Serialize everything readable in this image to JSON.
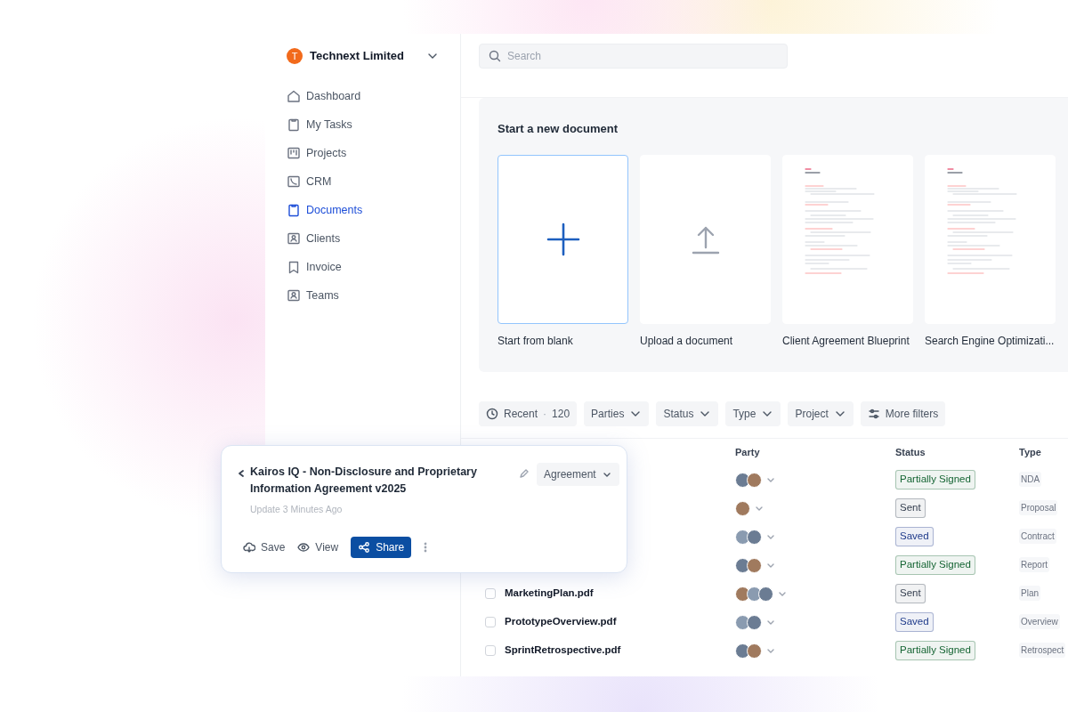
{
  "workspace": {
    "initial": "T",
    "name": "Technext Limited"
  },
  "sidebar": {
    "items": [
      {
        "label": "Dashboard",
        "kind": "home",
        "selected": false
      },
      {
        "label": "My Tasks",
        "kind": "clipboard",
        "selected": false
      },
      {
        "label": "Projects",
        "kind": "board",
        "selected": false
      },
      {
        "label": "CRM",
        "kind": "phone",
        "selected": false
      },
      {
        "label": "Documents",
        "kind": "clipboard",
        "selected": true
      },
      {
        "label": "Clients",
        "kind": "person",
        "selected": false
      },
      {
        "label": "Invoice",
        "kind": "bookmark",
        "selected": false
      },
      {
        "label": "Teams",
        "kind": "person",
        "selected": false
      }
    ]
  },
  "search": {
    "placeholder": "Search"
  },
  "new_document": {
    "title": "Start a new document",
    "options": [
      {
        "kind": "blank",
        "label": "Start from blank",
        "selected": true
      },
      {
        "kind": "upload",
        "label": "Upload a document",
        "selected": false
      },
      {
        "kind": "template",
        "label": "Client Agreement Blueprint",
        "selected": false
      },
      {
        "kind": "template",
        "label": "Search Engine Optimizati...",
        "selected": false
      }
    ]
  },
  "filters": [
    {
      "kind": "recent",
      "label": "Recent",
      "separator": "·",
      "count": "120"
    },
    {
      "kind": "dropdown",
      "label": "Parties"
    },
    {
      "kind": "dropdown",
      "label": "Status"
    },
    {
      "kind": "dropdown",
      "label": "Type"
    },
    {
      "kind": "dropdown",
      "label": "Project"
    },
    {
      "kind": "more",
      "label": "More filters"
    }
  ],
  "table": {
    "columns": [
      "Party",
      "Status",
      "Type"
    ],
    "rows": [
      {
        "parties": [
          {
            "kind": "photo"
          },
          {
            "kind": "photo"
          }
        ],
        "status": {
          "label": "Partially Signed",
          "color": "#166534"
        },
        "type": "NDA"
      },
      {
        "parties": [
          {
            "kind": "photo"
          }
        ],
        "status": {
          "label": "Sent",
          "color": "#374151"
        },
        "type": "Proposal"
      },
      {
        "parties": [
          {
            "kind": "photo"
          },
          {
            "kind": "photo"
          }
        ],
        "status": {
          "label": "Saved",
          "color": "#1e3a8a"
        },
        "type": "Contract"
      },
      {
        "parties": [
          {
            "kind": "photo"
          },
          {
            "kind": "photo"
          }
        ],
        "status": {
          "label": "Partially Signed",
          "color": "#166534"
        },
        "type": "Report"
      },
      {
        "name": "MarketingPlan.pdf",
        "checked": false,
        "parties": [
          {
            "kind": "photo"
          },
          {
            "kind": "photo"
          },
          {
            "kind": "photo"
          }
        ],
        "status": {
          "label": "Sent",
          "color": "#374151"
        },
        "type": "Plan"
      },
      {
        "name": "PrototypeOverview.pdf",
        "checked": false,
        "parties": [
          {
            "kind": "photo"
          },
          {
            "kind": "photo"
          }
        ],
        "status": {
          "label": "Saved",
          "color": "#1e3a8a"
        },
        "type": "Overview"
      },
      {
        "name": "SprintRetrospective.pdf",
        "checked": false,
        "parties": [
          {
            "kind": "photo"
          },
          {
            "kind": "photo"
          }
        ],
        "status": {
          "label": "Partially Signed",
          "color": "#166534"
        },
        "type": "Retrospect"
      }
    ]
  },
  "document_card": {
    "title": "Kairos IQ - Non-Disclosure and Proprietary Information Agreement v2025",
    "category": "Agreement",
    "updated": "Update 3 Minutes Ago",
    "actions": [
      {
        "kind": "save",
        "label": "Save"
      },
      {
        "kind": "view",
        "label": "View"
      },
      {
        "kind": "share",
        "label": "Share"
      }
    ]
  }
}
